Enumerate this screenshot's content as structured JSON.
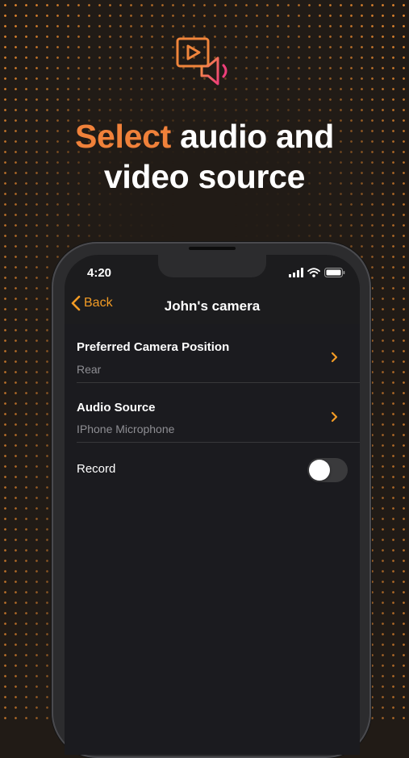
{
  "hero": {
    "icon": "video-audio-source-icon",
    "headline_accent": "Select",
    "headline_rest_1": " audio and",
    "headline_line_2": "video source"
  },
  "status_bar": {
    "time": "4:20",
    "icons": [
      "signal-icon",
      "wifi-icon",
      "battery-icon"
    ]
  },
  "nav": {
    "back_label": "Back",
    "title": "John's camera"
  },
  "settings": {
    "items": [
      {
        "title": "Preferred Camera Position",
        "value": "Rear"
      },
      {
        "title": "Audio Source",
        "value": "IPhone Microphone"
      }
    ],
    "record": {
      "label": "Record",
      "enabled": false
    }
  },
  "colors": {
    "accent_orange": "#f0813a",
    "ios_orange": "#f29b25",
    "icon_pink": "#ee3f7a",
    "background": "#211b16",
    "screen": "#1c1c1e"
  }
}
